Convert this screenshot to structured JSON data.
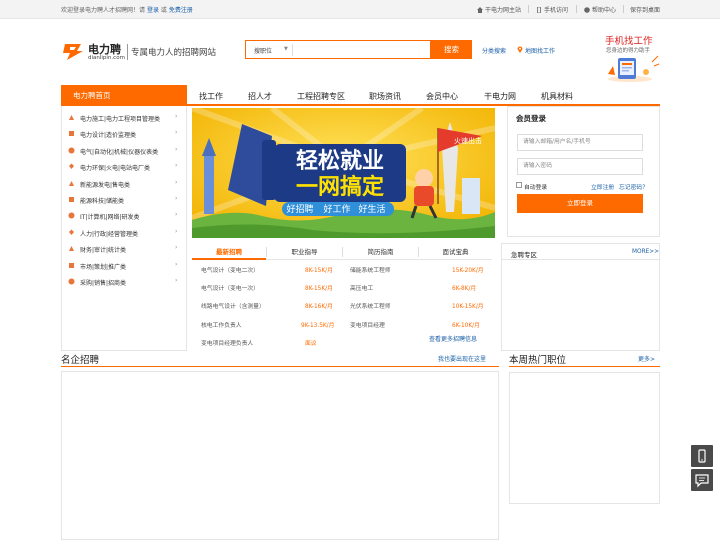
{
  "topbar": {
    "welcome_prefix": "欢迎登录电力聘人才招聘网！请",
    "login": "登录",
    "or": "或",
    "register": "免费注册",
    "links": [
      "干电力网主站",
      "手机访问",
      "帮助中心",
      "保存到桌面"
    ]
  },
  "header": {
    "logo_name": "电力聘",
    "logo_domain": "dianlipin.com",
    "slogan": "专属电力人的招聘网站",
    "search": {
      "category": "搜职位",
      "placeholder": "",
      "button": "搜索"
    },
    "category_search": "分类搜索",
    "map_search": "地图找工作",
    "mobile_title": "手机找工作",
    "mobile_sub": "您身边的得力助手"
  },
  "nav": {
    "active": "电力聘首页",
    "items": [
      "找工作",
      "招人才",
      "工程招聘专区",
      "职场资讯",
      "会员中心",
      "干电力网",
      "机具材料"
    ]
  },
  "sidebar": {
    "items": [
      {
        "label": "电力施工|电力工程项目管理类",
        "color": "#e8763a"
      },
      {
        "label": "电力设计|造价监理类",
        "color": "#e8763a"
      },
      {
        "label": "电气|自动化|机械|仪器仪表类",
        "color": "#e8763a"
      },
      {
        "label": "电力环保|火电|电站电厂类",
        "color": "#e8763a"
      },
      {
        "label": "新能源发电|售电类",
        "color": "#e8763a"
      },
      {
        "label": "能源科技|储能类",
        "color": "#e8763a"
      },
      {
        "label": "IT|计算机|网络|研发类",
        "color": "#e8763a"
      },
      {
        "label": "人力|行政|经营管理类",
        "color": "#e8763a"
      },
      {
        "label": "财务|审计|统计类",
        "color": "#e8763a"
      },
      {
        "label": "市场|策划|推广类",
        "color": "#e8763a"
      },
      {
        "label": "采购|销售|招商类",
        "color": "#e8763a"
      }
    ]
  },
  "banner": {
    "line1": "轻松就业",
    "line2": "一网搞定",
    "tags": [
      "好招聘",
      "好工作",
      "好生活"
    ],
    "flag": "火速出击"
  },
  "tabs": [
    "最新招聘",
    "职业指导",
    "简历指南",
    "面试宝典"
  ],
  "jobs_left": [
    {
      "title": "电气设计（变电二次）",
      "salary": "8K-15K/月"
    },
    {
      "title": "电气设计（变电一次）",
      "salary": "8K-15K/月"
    },
    {
      "title": "线路电气设计（含测量）",
      "salary": "8K-16K/月"
    },
    {
      "title": "核电工作负责人",
      "salary": "9K-13.5K/月"
    },
    {
      "title": "变电项目经理负责人",
      "salary": "面议"
    }
  ],
  "jobs_right": [
    {
      "title": "储能系统工程师",
      "salary": "15K-20K/月"
    },
    {
      "title": "高压电工",
      "salary": "6K-8K/月"
    },
    {
      "title": "光伏系统工程师",
      "salary": "10K-15K/月"
    },
    {
      "title": "变电项目经理",
      "salary": "6K-10K/月"
    }
  ],
  "list_more": "查看更多招聘信息",
  "login": {
    "title": "会员登录",
    "user_placeholder": "请输入邮箱/用户名/手机号",
    "pass_placeholder": "请输入密码",
    "auto": "自动登录",
    "register": "立即注册",
    "forgot": "忘记密码？",
    "button": "立即登录"
  },
  "urgent": {
    "title": "急聘专区",
    "more": "MORE>>"
  },
  "famous": {
    "title": "名企招聘",
    "link": "我也要出现在这里"
  },
  "hot": {
    "title": "本周热门职位",
    "more": "更多>"
  }
}
